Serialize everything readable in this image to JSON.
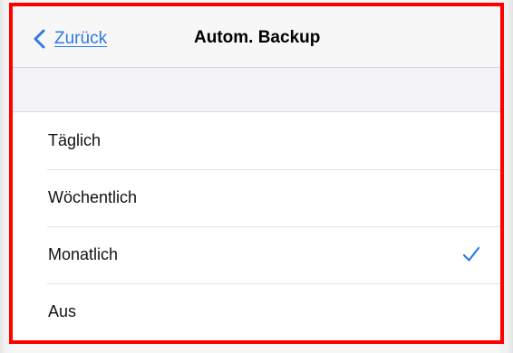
{
  "nav": {
    "back_label": "Zurück",
    "title": "Autom. Backup"
  },
  "options": [
    {
      "label": "Täglich",
      "selected": false
    },
    {
      "label": "Wöchentlich",
      "selected": false
    },
    {
      "label": "Monatlich",
      "selected": true
    },
    {
      "label": "Aus",
      "selected": false
    }
  ],
  "colors": {
    "accent": "#2f7ae5",
    "highlight_border": "#ff0000"
  },
  "icons": {
    "back": "chevron-left-icon",
    "selected": "checkmark-icon"
  }
}
